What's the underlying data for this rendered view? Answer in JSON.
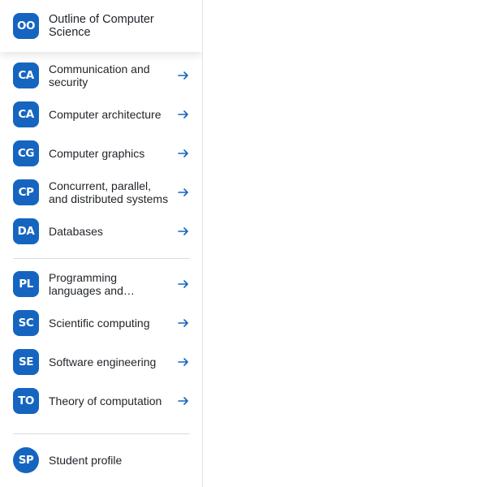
{
  "sidebar": {
    "header": {
      "badge": "OO",
      "title": "Outline of Computer Science"
    },
    "group1": [
      {
        "badge": "CA",
        "label": "Communication and security"
      },
      {
        "badge": "CA",
        "label": "Computer architecture"
      },
      {
        "badge": "CG",
        "label": "Computer graphics"
      },
      {
        "badge": "CP",
        "label": "Concurrent, parallel, and distributed systems"
      },
      {
        "badge": "DA",
        "label": "Databases"
      }
    ],
    "group2": [
      {
        "badge": "PL",
        "label": "Programming languages and…"
      },
      {
        "badge": "SC",
        "label": "Scientific computing"
      },
      {
        "badge": "SE",
        "label": "Software engineering"
      },
      {
        "badge": "TO",
        "label": "Theory of computation"
      }
    ],
    "footer": {
      "badge": "SP",
      "label": "Student profile"
    }
  },
  "colors": {
    "badge_bg": "#1565c0",
    "arrow": "#1565c0",
    "text": "#1f2328"
  },
  "icons": {
    "arrow": "arrow-right-icon"
  }
}
